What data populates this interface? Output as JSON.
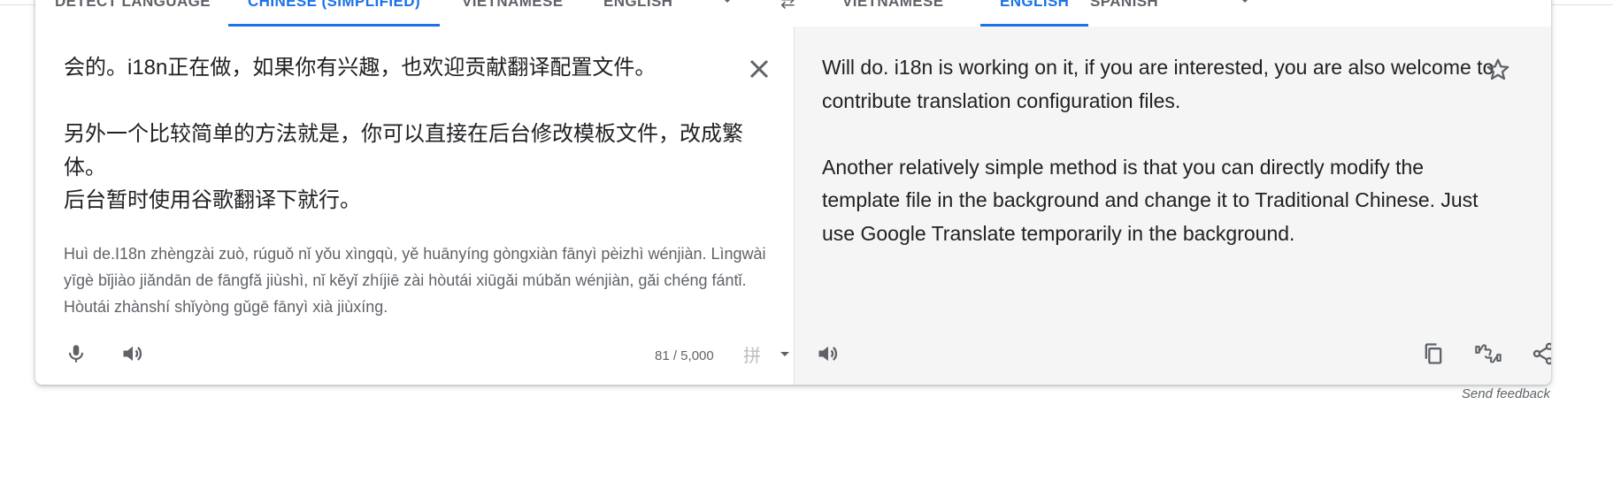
{
  "source_tabs": [
    {
      "label": "Detect language",
      "active": false
    },
    {
      "label": "Chinese (Simplified)",
      "active": true
    },
    {
      "label": "Vietnamese",
      "active": false
    },
    {
      "label": "English",
      "active": false
    }
  ],
  "target_tabs": [
    {
      "label": "Vietnamese",
      "active": false
    },
    {
      "label": "English",
      "active": true
    },
    {
      "label": "Spanish",
      "active": false
    }
  ],
  "source": {
    "text": "会的。i18n正在做，如果你有兴趣，也欢迎贡献翻译配置文件。\n\n另外一个比较简单的方法就是，你可以直接在后台修改模板文件，改成繁体。\n后台暂时使用谷歌翻译下就行。",
    "transliteration": "Huì de.I18n zhèngzài zuò, rúguǒ nǐ yǒu xìngqù, yě huānyíng gòngxiàn fānyì pèizhì wénjiàn. Lìngwài yīgè bǐjiào jiǎndān de fāngfǎ jiùshì, nǐ kěyǐ zhíjiē zài hòutái xiūgǎi múbǎn wénjiàn, gǎi chéng fántǐ. Hòutái zhànshí shǐyòng gǔgē fānyì xià jiùxíng.",
    "char_count": "81 / 5,000",
    "handwriting_glyph": "拼"
  },
  "target": {
    "text": "Will do. i18n is working on it, if you are interested, you are also welcome to contribute translation configuration files.\n\nAnother relatively simple method is that you can directly modify the template file in the background and change it to Traditional Chinese. Just use Google Translate temporarily in the background."
  },
  "footer": {
    "send_feedback": "Send feedback"
  },
  "colors": {
    "accent": "#1a73e8",
    "icon": "#5f6368",
    "target_bg": "#f5f5f5"
  },
  "icons": {
    "swap": "swap-arrows-icon",
    "clear": "close-icon",
    "mic": "microphone-icon",
    "speaker": "speaker-icon",
    "star": "star-icon",
    "copy": "copy-icon",
    "rate": "thumbs-rating-icon",
    "share": "share-icon"
  }
}
